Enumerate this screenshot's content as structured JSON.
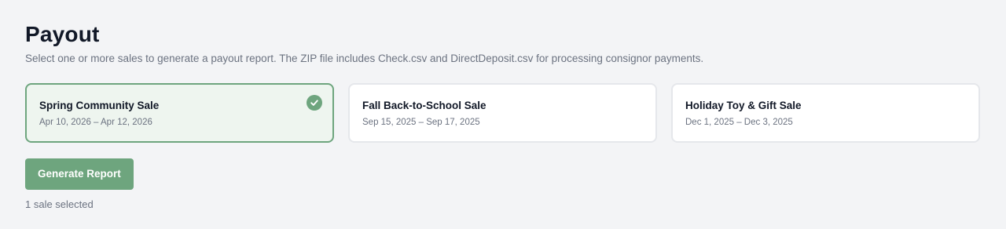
{
  "page": {
    "title": "Payout",
    "description": "Select one or more sales to generate a payout report. The ZIP file includes Check.csv and DirectDeposit.csv for processing consignor payments."
  },
  "sales": [
    {
      "name": "Spring Community Sale",
      "dates": "Apr 10, 2026 – Apr 12, 2026",
      "selected": true
    },
    {
      "name": "Fall Back-to-School Sale",
      "dates": "Sep 15, 2025 – Sep 17, 2025",
      "selected": false
    },
    {
      "name": "Holiday Toy & Gift Sale",
      "dates": "Dec 1, 2025 – Dec 3, 2025",
      "selected": false
    }
  ],
  "actions": {
    "generate_label": "Generate Report"
  },
  "selection": {
    "status": "1 sale selected"
  },
  "icons": {
    "selected": "check-circle-icon"
  },
  "colors": {
    "accent": "#6ea57e",
    "selected_bg": "#eef5ef",
    "page_bg": "#f3f4f6",
    "muted_text": "#6b7280"
  }
}
